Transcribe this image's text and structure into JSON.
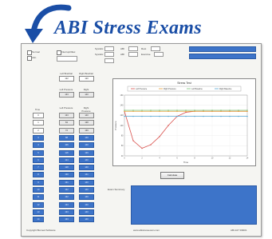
{
  "banner": {
    "title": "ABI Stress Exams"
  },
  "app": {
    "options": {
      "left_checks": [
        "Normal",
        "Abn"
      ],
      "mid_check": "Interrupt/Iliac",
      "fields": [
        "Systolic",
        "Systolic",
        "ABI",
        "ABI",
        "Rest",
        "Exercise"
      ]
    },
    "pressures": {
      "left_brachial": {
        "label": "Left Brachial",
        "value": "122"
      },
      "right_brachial": {
        "label": "Right Brachial",
        "value": "120"
      },
      "left_ankle": {
        "label": "Left Pressure",
        "value": "133"
      },
      "right_ankle": {
        "label": "Right Pressure",
        "value": "140"
      }
    },
    "table": {
      "time_header": "Time",
      "left_header": "Left Pressure",
      "right_header": "Right Pressure",
      "time_values": [
        "0",
        "1",
        "2",
        "3",
        "4",
        "5",
        "6",
        "7",
        "8",
        "9",
        "10",
        "11",
        "12",
        "13",
        "14"
      ],
      "left_values": [
        "133",
        "84",
        "72",
        "88",
        "106",
        "118",
        "124",
        "128",
        "130",
        "131",
        "132",
        "132",
        "133",
        "133",
        "133"
      ],
      "right_values": [
        "140",
        "138",
        "139",
        "140",
        "140",
        "139",
        "140",
        "140",
        "141",
        "140",
        "140",
        "140",
        "140",
        "140",
        "140"
      ]
    },
    "chart": {
      "title": "Stress Test",
      "legend": [
        "Left Pressure",
        "Right Pressure",
        "Left Baseline",
        "Right Baseline"
      ],
      "xlabel": "Time",
      "ylabel": "Pressure"
    },
    "calc_button": "Calculate",
    "summary_label": "Exam Summary",
    "summary_text": "",
    "footer_left": "Copyright Biomed Software",
    "footer_mid": "www.abistressexam.com",
    "footer_right": "ABI-107 R0001"
  },
  "chart_data": {
    "type": "line",
    "title": "Stress Test",
    "xlabel": "Time",
    "ylabel": "Pressure",
    "x": [
      0,
      1,
      2,
      3,
      4,
      5,
      6,
      7,
      8,
      9,
      10,
      11,
      12,
      13,
      14
    ],
    "xlim": [
      0,
      14
    ],
    "ylim": [
      40,
      160
    ],
    "series": [
      {
        "name": "Left Pressure",
        "color": "#d9534f",
        "values": [
          128,
          70,
          55,
          62,
          78,
          100,
          118,
          126,
          128,
          128,
          128,
          128,
          128,
          128,
          128
        ]
      },
      {
        "name": "Right Pressure",
        "color": "#e8a13a",
        "values": [
          128,
          128,
          128,
          128,
          128,
          128,
          128,
          128,
          128,
          128,
          128,
          128,
          128,
          128,
          128
        ]
      },
      {
        "name": "Left Baseline",
        "color": "#7cc47a",
        "values": [
          130,
          130,
          130,
          130,
          130,
          130,
          130,
          130,
          130,
          130,
          130,
          130,
          130,
          130,
          130
        ]
      },
      {
        "name": "Right Baseline",
        "color": "#5aa9d6",
        "values": [
          118,
          118,
          118,
          118,
          118,
          118,
          118,
          118,
          118,
          118,
          118,
          118,
          118,
          118,
          118
        ]
      }
    ],
    "grid": true,
    "legend_position": "top"
  }
}
